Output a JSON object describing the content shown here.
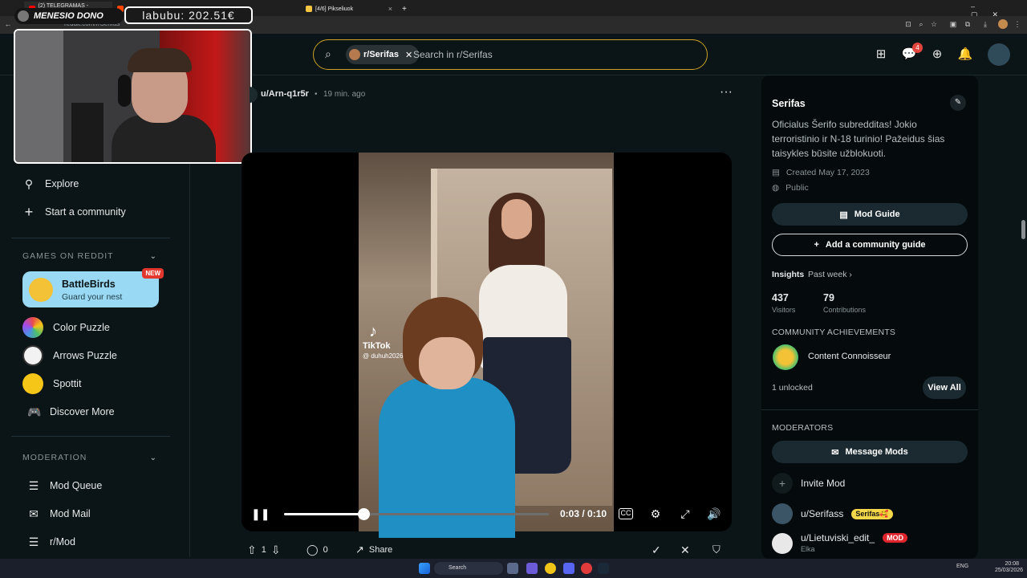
{
  "browser": {
    "tabs": [
      {
        "title": "(2) TELEGRAMAS - YouTube",
        "color": "#ff0000"
      },
      {
        "title": "S",
        "color": "#ff4500"
      },
      {
        "title": "[4/6] Pikseliuok",
        "color": "#f4c542"
      }
    ],
    "new_tab": "+",
    "url": "reddit.com/r/Serifas"
  },
  "stream_overlay": {
    "donor_label": "MENESIO DONO",
    "counter": "labubu: 202.51€"
  },
  "header": {
    "search_chip": "r/Serifas",
    "search_placeholder": "Search in r/Serifas",
    "chat_badge": "4"
  },
  "sidebar": {
    "nav": [
      {
        "label": "Explore",
        "icon": "explore-icon"
      },
      {
        "label": "Start a community",
        "icon": "plus-icon"
      }
    ],
    "games_header": "GAMES ON REDDIT",
    "featured_game": {
      "title": "BattleBirds",
      "subtitle": "Guard your nest",
      "badge": "NEW",
      "logo_text": "BATTLE BIRDS"
    },
    "games": [
      {
        "label": "Color Puzzle",
        "color": "#6a5acd"
      },
      {
        "label": "Arrows Puzzle",
        "color": "#ffffff"
      },
      {
        "label": "Spottit",
        "color": "#f5c518"
      },
      {
        "label": "Discover More",
        "color": ""
      }
    ],
    "moderation_header": "MODERATION",
    "moderation": [
      {
        "label": "Mod Queue",
        "icon": "mod-queue-icon"
      },
      {
        "label": "Mod Mail",
        "icon": "mod-mail-icon"
      },
      {
        "label": "r/Mod",
        "icon": "mod-list-icon"
      }
    ]
  },
  "post": {
    "author": "u/Arn-q1r5r",
    "time": "19 min. ago",
    "video": {
      "watermark_brand": "TikTok",
      "watermark_handle": "@ duhuh2026",
      "current_time": "0:03",
      "duration": "0:10",
      "progress_fraction": 0.3
    },
    "actions": {
      "votes": "1",
      "comments": "0",
      "share": "Share"
    }
  },
  "community": {
    "name": "Serifas",
    "description": "Oficialus Šerifo subredditas! Jokio terroristinio ir N-18 turinio! Pažeidus šias taisykles būsite užblokuoti.",
    "created": "Created May 17, 2023",
    "visibility": "Public",
    "mod_guide_label": "Mod Guide",
    "add_guide_label": "Add a community guide",
    "insights_label": "Insights",
    "insights_range": "Past week",
    "visitors": "437",
    "visitors_label": "Visitors",
    "contributions": "79",
    "contributions_label": "Contributions",
    "achievements_header": "COMMUNITY ACHIEVEMENTS",
    "achievement": "Content Connoisseur",
    "unlocked": "1 unlocked",
    "view_all": "View All",
    "moderators_header": "MODERATORS",
    "message_mods": "Message Mods",
    "invite_mod": "Invite Mod",
    "mods": [
      {
        "name": "u/Serifass",
        "flair": "Serifas🥰",
        "flair_color": "#f5d84a"
      },
      {
        "name": "u/Lietuviski_edit_",
        "flair": "MOD",
        "flair_color": "#e0242b",
        "sub": "Elka"
      }
    ]
  },
  "taskbar": {
    "search": "Search",
    "lang": "ENG",
    "time": "20:08",
    "date": "25/03/2026"
  }
}
